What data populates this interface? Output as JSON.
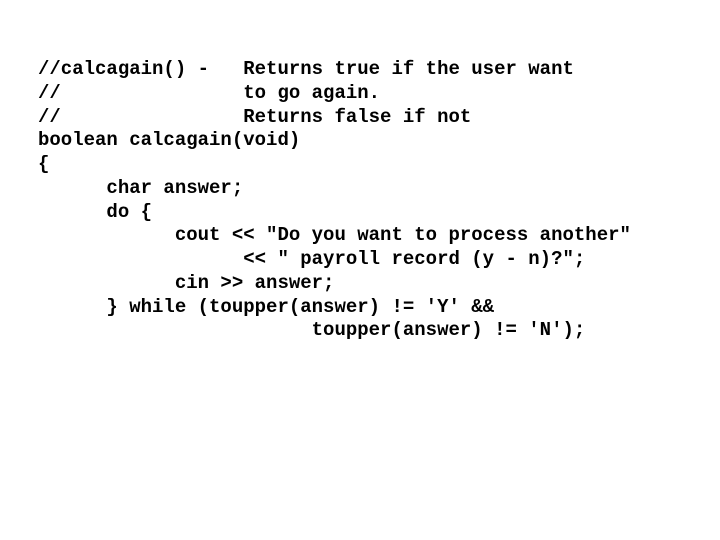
{
  "code": {
    "lines": [
      "//calcagain() -   Returns true if the user want",
      "//                to go again.",
      "//                Returns false if not",
      "boolean calcagain(void)",
      "{",
      "      char answer;",
      "",
      "      do {",
      "            cout << \"Do you want to process another\"",
      "                  << \" payroll record (y - n)?\";",
      "            cin >> answer;",
      "      } while (toupper(answer) != 'Y' &&",
      "                        toupper(answer) != 'N');"
    ]
  }
}
